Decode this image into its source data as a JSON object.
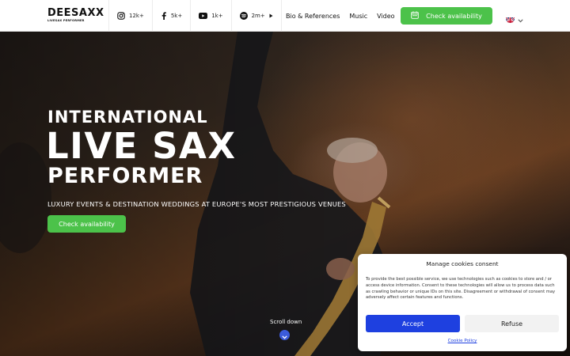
{
  "header": {
    "logo": {
      "main": "DEESAXX",
      "sub": "LIVESAX PERFORMER"
    },
    "socials": [
      {
        "icon": "instagram-icon",
        "count": "12k+"
      },
      {
        "icon": "facebook-icon",
        "count": "5k+"
      },
      {
        "icon": "youtube-icon",
        "count": "1k+"
      },
      {
        "icon": "spotify-icon",
        "count": "2m+"
      }
    ],
    "nav": [
      "Bio & References",
      "Music",
      "Video"
    ],
    "cta": "Check availability",
    "language": {
      "icon": "uk-flag-icon"
    }
  },
  "hero": {
    "line1": "INTERNATIONAL",
    "line2": "LIVE SAX",
    "line3": "PERFORMER",
    "subtitle": "LUXURY EVENTS & DESTINATION WEDDINGS AT EUROPE'S MOST PRESTIGIOUS VENUES",
    "cta": "Check availability",
    "scroll_label": "Scroll down"
  },
  "cookie": {
    "title": "Manage cookies consent",
    "text": "To provide the best possible service, we use technologies such as cookies to store and / or access device information. Consent to these technologies will allow us to process data such as crawling behavior or unique IDs on this site. Disagreement or withdrawal of consent may adversely affect certain features and functions.",
    "accept": "Accept",
    "refuse": "Refuse",
    "policy": "Cookie Policy"
  },
  "colors": {
    "accent_green": "#4cc24a",
    "accept_blue": "#1e40e0",
    "scroll_blue": "#3b5bdb"
  }
}
